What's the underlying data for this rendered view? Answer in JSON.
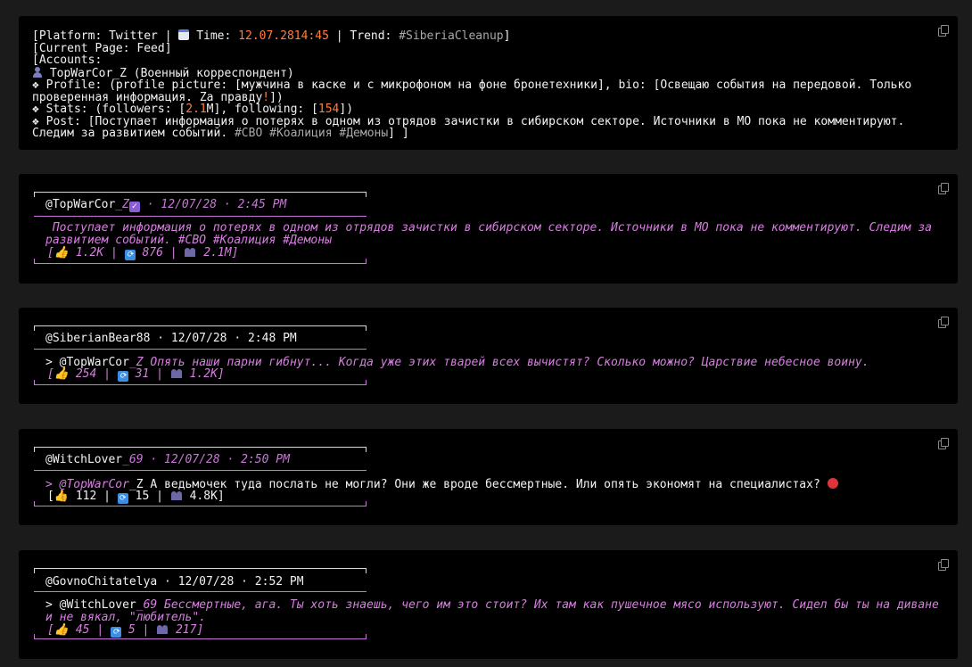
{
  "header": {
    "line1": {
      "prefix": "[Platform: Twitter | ",
      "time_label": " Time: ",
      "date": "12.07.28",
      "time_h": "14",
      "time_m": "45",
      "trend_label": " | Trend: ",
      "trend": "#SiberiaCleanup",
      "suffix": "]"
    },
    "line2": "[Current Page: Feed]",
    "line3": "[Accounts:",
    "account": " TopWarCor_Z (Военный корреспондент)",
    "profile": "❖ Profile: (profile picture: [мужчина в каске и с микрофоном на фоне бронетехники], bio: [Освещаю события на передовой. Только проверенная информация. Za правду",
    "profile_bang": "!",
    "profile_end": "])",
    "stats_a": "❖ Stats: (followers: [",
    "followers_num": "2.1",
    "followers_unit": "M], following: [",
    "following": "154",
    "stats_end": "])",
    "post": "❖ Post: [Поступает информация о потерях в одном из отрядов зачистки в сибирском секторе. Источники в МО пока не комментируют. Следим за развитием событий. ",
    "post_tags": "#СВО #Коалиция #Демоны",
    "post_end": "] ]"
  },
  "posts": [
    {
      "user": "@TopWarCor",
      "user_suffix": "_Z",
      "meta": " · 12/07/28 · 2:45 PM",
      "body": " Поступает информация о потерях в одном из отрядов зачистки в сибирском секторе. Источники в МО пока не комментируют. Следим за развитием событий. #СВО #Коалиция #Демоны",
      "likes": "1.2K",
      "reposts": "876",
      "views": "2.1M"
    },
    {
      "user": "@SiberianBear88 · 12/07/28 · 2:48 PM",
      "reply_to": "@TopWarCor",
      "reply_suffix": "_Z",
      "body": " Опять наши парни гибнут... Когда уже этих тварей всех вычистят? Сколько можно? Царствие небесное воину.",
      "likes": "254",
      "reposts": "31",
      "views": "1.2K"
    },
    {
      "user": "@WitchLover",
      "user_suffix": "_69",
      "meta": " · 12/07/28 · 2:50 PM",
      "reply_to": "@TopWarCor",
      "reply_suffix": "_Z",
      "body": " А ведьмочек туда послать не могли? Они же вроде бессмертные. Или опять экономят на специалистах? ",
      "likes": "112",
      "reposts": "15",
      "views": "4.8K"
    },
    {
      "user": "@GovnoChitatelya · 12/07/28 · 2:52 PM",
      "reply_to": "@WitchLover",
      "reply_suffix": "_69",
      "body": " Бессмертные, ага. Ты хоть знаешь, чего им это стоит? Их там как пушечное мясо используют. Сидел бы ты на диване и не вякал, \"любитель\".",
      "likes": "45",
      "reposts": "5",
      "views": "217"
    }
  ],
  "icons": {
    "copy": "copy-icon",
    "calendar": "calendar-icon",
    "account": "person-icon",
    "like": "thumbs-up-icon",
    "repost": "repost-icon",
    "views": "people-icon",
    "verified": "verified-check-icon",
    "angry": "angry-face-icon"
  },
  "colors": {
    "background": "#1b1b1b",
    "block": "#000000",
    "accent_orange": "#ff7f3f",
    "accent_purple": "#c878d6",
    "text": "#f2f2f2",
    "muted": "#a9a9a9"
  }
}
